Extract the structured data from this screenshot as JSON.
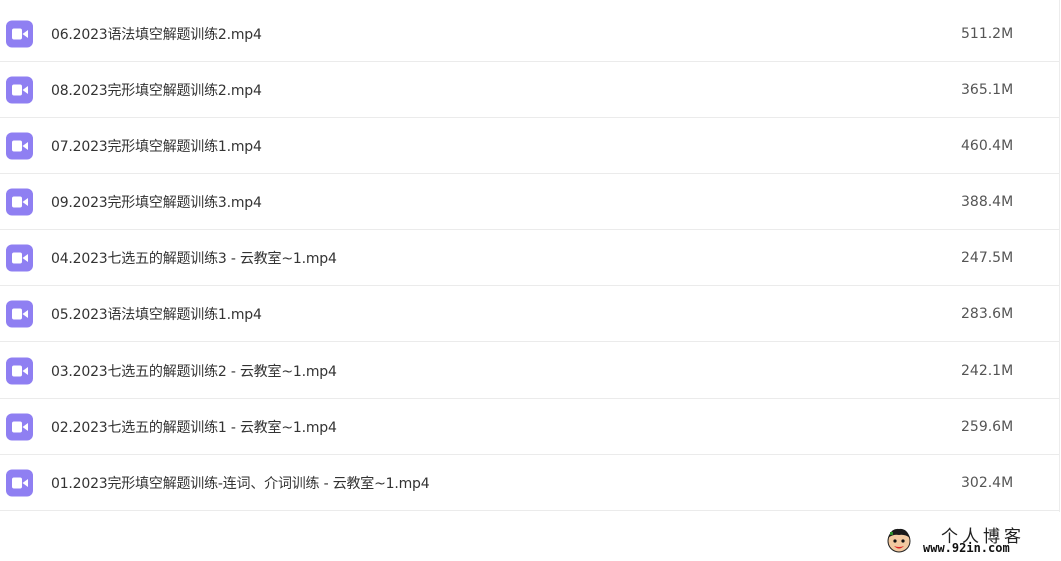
{
  "files": [
    {
      "name": "06.2023语法填空解题训练2.mp4",
      "size": "511.2M",
      "icon": "video-file-icon"
    },
    {
      "name": "08.2023完形填空解题训练2.mp4",
      "size": "365.1M",
      "icon": "video-file-icon"
    },
    {
      "name": "07.2023完形填空解题训练1.mp4",
      "size": "460.4M",
      "icon": "video-file-icon"
    },
    {
      "name": "09.2023完形填空解题训练3.mp4",
      "size": "388.4M",
      "icon": "video-file-icon"
    },
    {
      "name": "04.2023七选五的解题训练3 - 云教室~1.mp4",
      "size": "247.5M",
      "icon": "video-file-icon"
    },
    {
      "name": "05.2023语法填空解题训练1.mp4",
      "size": "283.6M",
      "icon": "video-file-icon"
    },
    {
      "name": "03.2023七选五的解题训练2 - 云教室~1.mp4",
      "size": "242.1M",
      "icon": "video-file-icon"
    },
    {
      "name": "02.2023七选五的解题训练1 - 云教室~1.mp4",
      "size": "259.6M",
      "icon": "video-file-icon"
    },
    {
      "name": "01.2023完形填空解题训练-连词、介词训练 - 云教室~1.mp4",
      "size": "302.4M",
      "icon": "video-file-icon"
    }
  ],
  "watermark": {
    "title": "个人博客",
    "url": "www.92in.com",
    "logo": "cartoon-face-logo"
  },
  "colors": {
    "icon_bg": "#8f7ff2",
    "row_divider": "#ebebeb",
    "text": "#333333"
  }
}
